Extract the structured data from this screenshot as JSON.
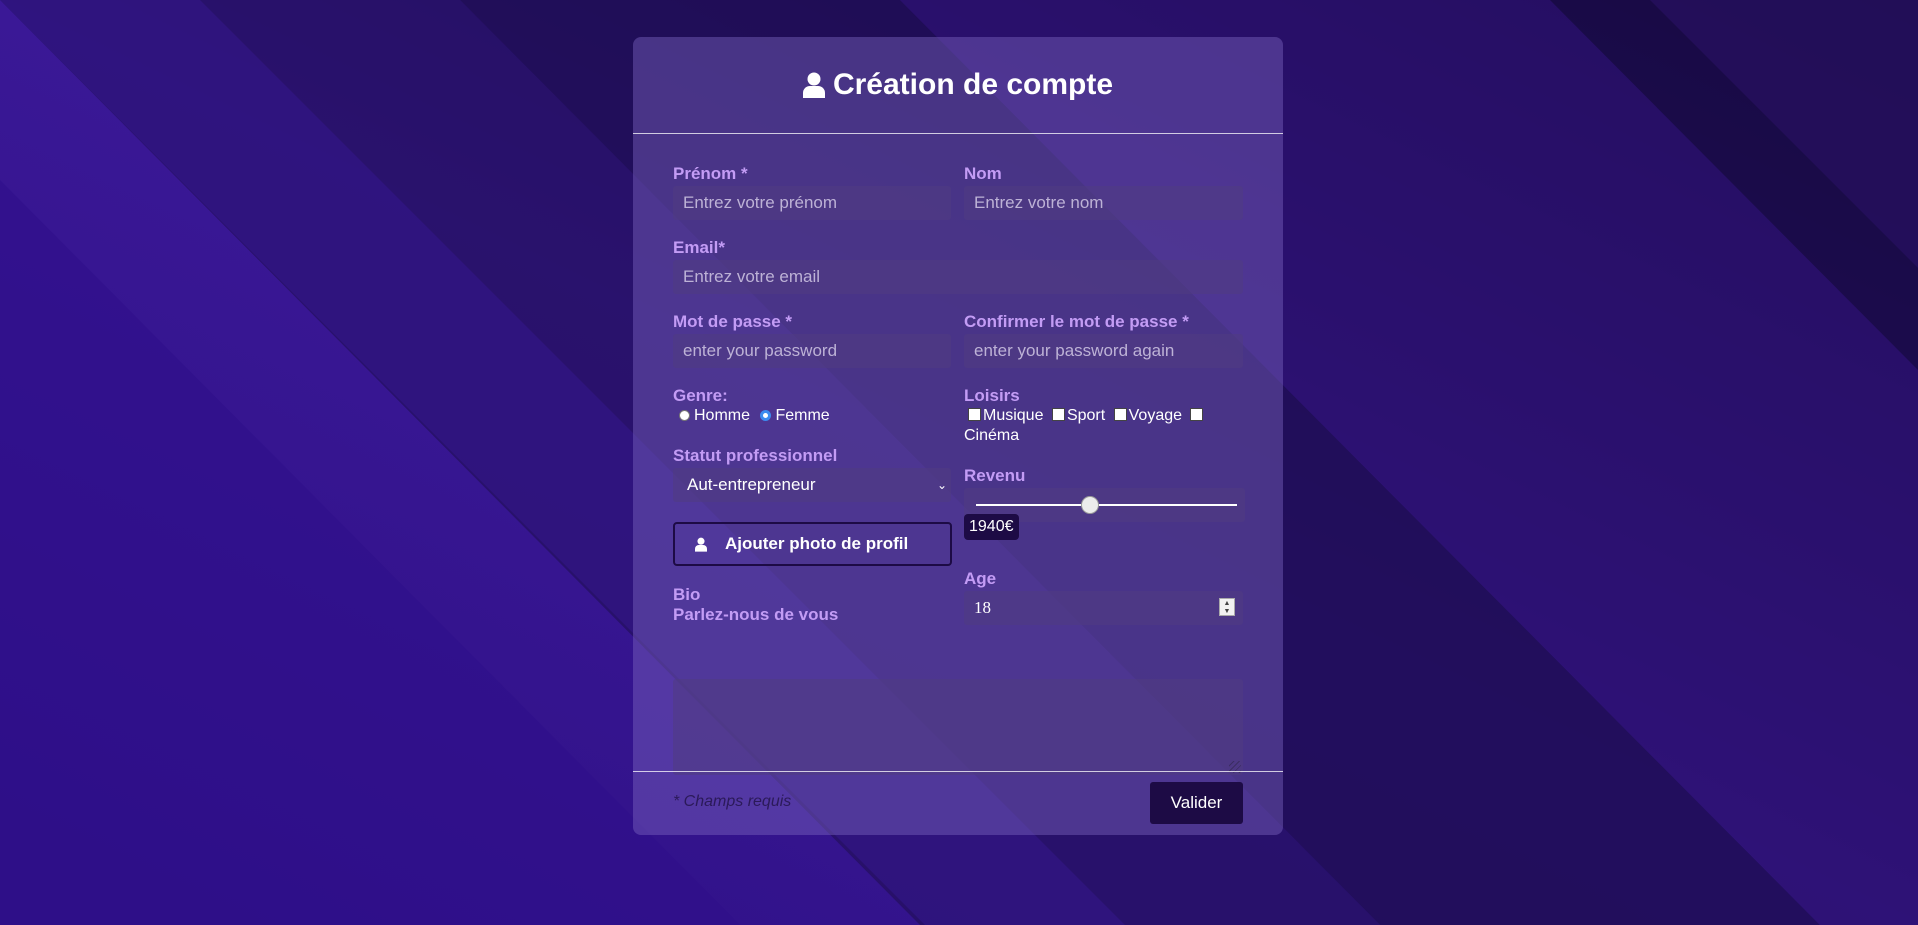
{
  "form": {
    "title": "Création de compte",
    "prenom": {
      "label": "Prénom *",
      "placeholder": "Entrez votre prénom"
    },
    "nom": {
      "label": "Nom",
      "placeholder": "Entrez votre nom"
    },
    "email": {
      "label": "Email*",
      "placeholder": "Entrez votre email"
    },
    "password": {
      "label": "Mot de passe *",
      "placeholder": "enter your password"
    },
    "confirm": {
      "label": "Confirmer le mot de passe *",
      "placeholder": "enter your password again"
    },
    "genre": {
      "label": "Genre:",
      "options": [
        "Homme",
        "Femme"
      ],
      "selected": "Femme"
    },
    "loisirs": {
      "label": "Loisirs",
      "options": [
        "Musique",
        "Sport",
        "Voyage",
        "Cinéma"
      ]
    },
    "statut": {
      "label": "Statut professionnel",
      "selected": "Aut-entrepreneur"
    },
    "revenu": {
      "label": "Revenu",
      "display": "1940€",
      "position_fraction": 0.435
    },
    "photo_button": "Ajouter photo de profil",
    "bio": {
      "label": "Bio",
      "sublabel": "Parlez-nous de vous"
    },
    "age": {
      "label": "Age",
      "value": "18"
    },
    "required_note": "* Champs requis",
    "submit": "Valider"
  },
  "icons": {
    "title": "user-icon",
    "photo": "user-icon"
  },
  "colors": {
    "label": "#c39cf5",
    "button_dark": "#1d0b45",
    "background": "#22105a",
    "radio_selected": "#3d8cf0"
  }
}
